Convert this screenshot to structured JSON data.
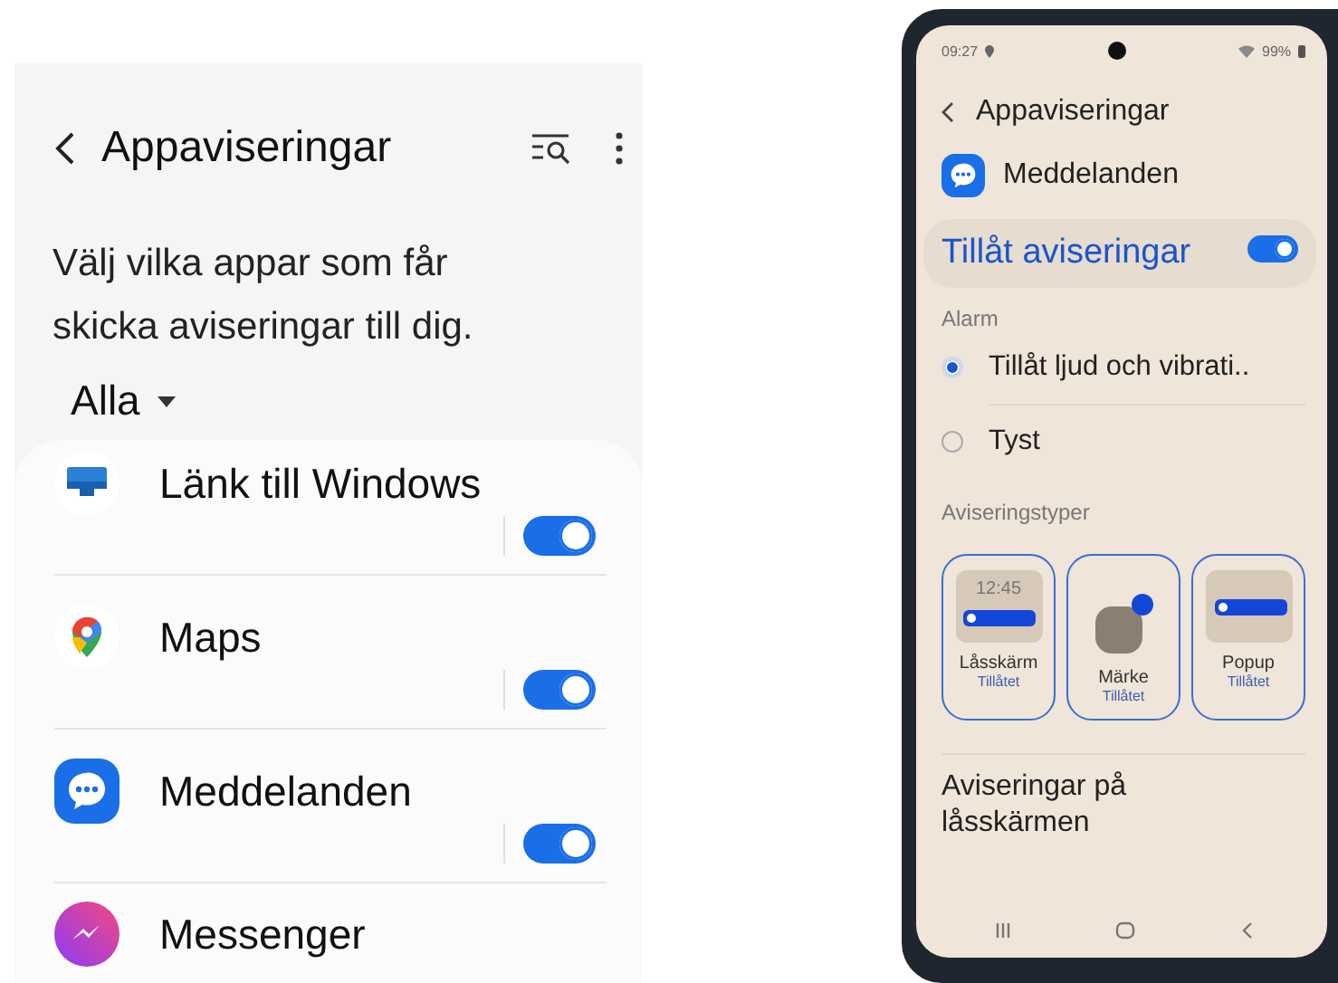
{
  "settings_screen": {
    "header": {
      "title": "Appaviseringar"
    },
    "description": "Välj vilka appar som får skicka aviseringar till dig.",
    "filter": {
      "value": "Alla"
    },
    "apps": [
      {
        "name": "Länk till Windows",
        "kind": "windows",
        "on": true
      },
      {
        "name": "Maps",
        "kind": "maps",
        "on": true
      },
      {
        "name": "Meddelanden",
        "kind": "messages",
        "on": true
      },
      {
        "name": "Messenger",
        "kind": "messenger"
      }
    ]
  },
  "phone_screen": {
    "status_bar": {
      "time": "09:27",
      "battery": "99%"
    },
    "header": {
      "title": "Appaviseringar"
    },
    "app": {
      "name": "Meddelanden"
    },
    "master": {
      "label": "Tillåt aviseringar",
      "on": true
    },
    "alarm": {
      "heading": "Alarm",
      "options": [
        {
          "label": "Tillåt ljud och vibrati..",
          "selected": true
        },
        {
          "label": "Tyst",
          "selected": false
        }
      ]
    },
    "types": {
      "heading": "Aviseringstyper",
      "items": [
        {
          "kind": "lockscreen",
          "name": "Låsskärm",
          "status": "Tillåtet",
          "clock": "12:45",
          "selected": true
        },
        {
          "kind": "badge",
          "name": "Märke",
          "status": "Tillåtet",
          "selected": true
        },
        {
          "kind": "popup",
          "name": "Popup",
          "status": "Tillåtet",
          "selected": true
        }
      ]
    },
    "lockscreen": {
      "label": "Aviseringar på låsskärmen"
    }
  }
}
